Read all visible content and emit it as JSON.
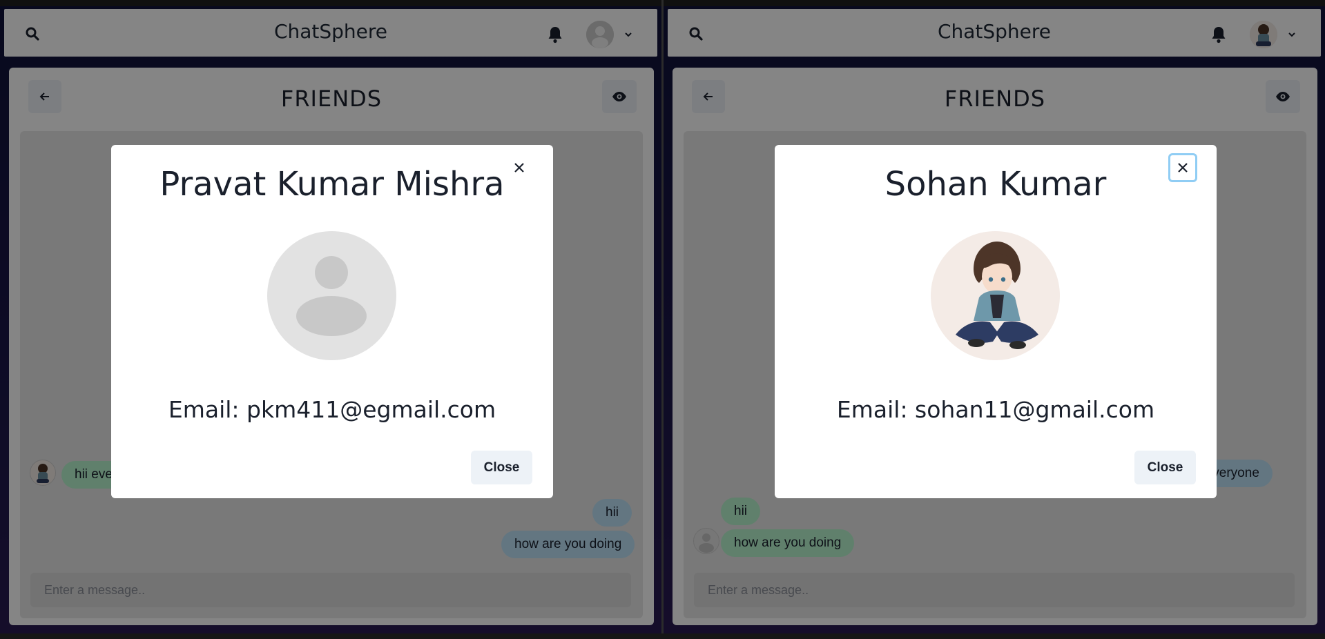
{
  "app": {
    "title": "ChatSphere"
  },
  "colors": {
    "accent": "#38B2AC",
    "bubble_green": "#B9F5D0",
    "bubble_blue": "#BEE3F8"
  },
  "left_pane": {
    "header": {
      "title": "ChatSphere",
      "icons": [
        "search-icon",
        "bell-icon",
        "user-avatar",
        "chevron-down-icon"
      ]
    },
    "chat": {
      "title": "FRIENDS",
      "messages": [
        {
          "text": "hii eve",
          "side": "left"
        },
        {
          "text": "hii",
          "side": "right"
        },
        {
          "text": "how are you doing",
          "side": "right"
        }
      ],
      "input_placeholder": "Enter a message.."
    },
    "modal": {
      "name": "Pravat Kumar Mishra",
      "email": "Email: pkm411@egmail.com",
      "close_label": "Close",
      "close_icon": "close-icon",
      "picture": "default-avatar"
    }
  },
  "right_pane": {
    "header": {
      "title": "ChatSphere",
      "icons": [
        "search-icon",
        "bell-icon",
        "user-avatar",
        "chevron-down-icon"
      ]
    },
    "chat": {
      "title": "FRIENDS",
      "messages": [
        {
          "text": "ii everyone",
          "side": "right"
        },
        {
          "text": "hii",
          "side": "left"
        },
        {
          "text": "how are you doing",
          "side": "left"
        }
      ],
      "input_placeholder": "Enter a message.."
    },
    "modal": {
      "name": "Sohan Kumar",
      "email": "Email: sohan11@gmail.com",
      "close_label": "Close",
      "close_icon": "close-icon",
      "picture": "anime-avatar"
    }
  }
}
